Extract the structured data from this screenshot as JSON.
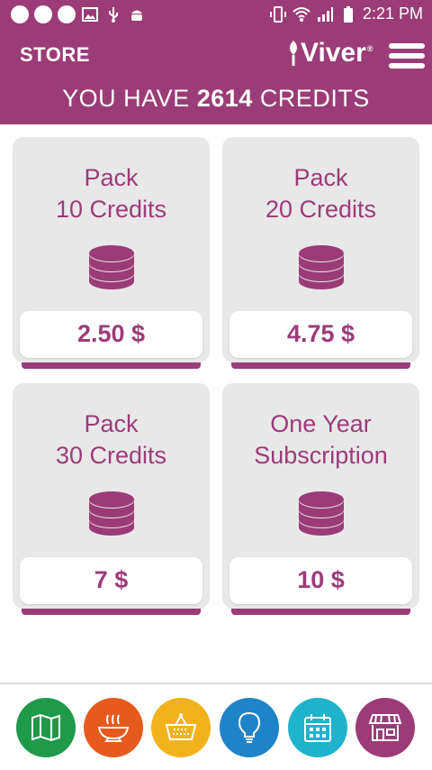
{
  "status_bar": {
    "time": "2:21 PM"
  },
  "header": {
    "section_label": "STORE",
    "brand_name": "Viver",
    "brand_mark": "®",
    "credits_prefix": "YOU HAVE",
    "credits_value": "2614",
    "credits_suffix": "CREDITS"
  },
  "packs": [
    {
      "title_line1": "Pack",
      "title_line2": "10 Credits",
      "price": "2.50 $",
      "icon": "coins-stack-icon"
    },
    {
      "title_line1": "Pack",
      "title_line2": "20 Credits",
      "price": "4.75 $",
      "icon": "coins-stack-icon"
    },
    {
      "title_line1": "Pack",
      "title_line2": "30 Credits",
      "price": "7 $",
      "icon": "coins-stack-icon"
    },
    {
      "title_line1": "One Year",
      "title_line2": "Subscription",
      "price": "10 $",
      "icon": "coins-stack-icon"
    }
  ],
  "bottom_nav": [
    {
      "icon": "map-icon",
      "color": "#1e9a4a"
    },
    {
      "icon": "food-bowl-icon",
      "color": "#e65a1e"
    },
    {
      "icon": "basket-icon",
      "color": "#f1b21c"
    },
    {
      "icon": "lightbulb-icon",
      "color": "#1f83c8"
    },
    {
      "icon": "calendar-icon",
      "color": "#1fb3cc"
    },
    {
      "icon": "store-icon",
      "color": "#9b3c78"
    }
  ],
  "colors": {
    "brand": "#9b3c78",
    "card_background": "#e9e8e9"
  }
}
